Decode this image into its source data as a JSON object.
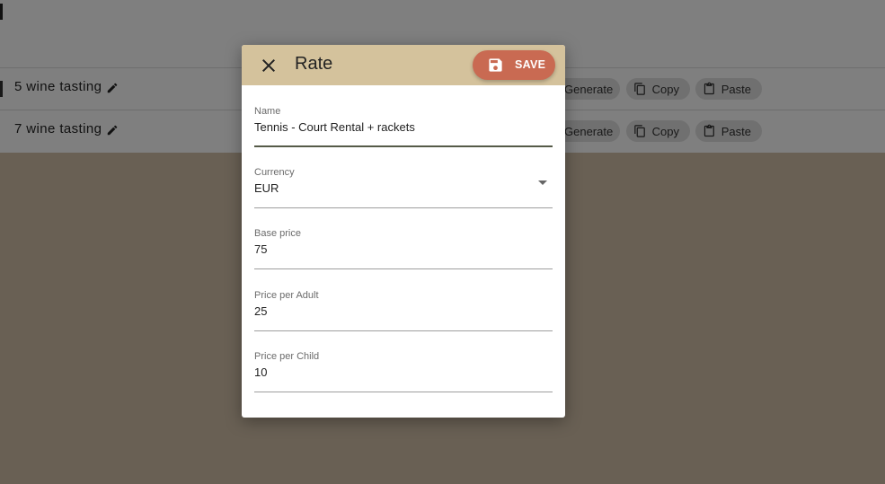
{
  "background": {
    "rows": [
      {
        "title": "5 wine tasting",
        "actions": {
          "generate": "Generate",
          "copy": "Copy",
          "paste": "Paste"
        }
      },
      {
        "title": "7 wine tasting",
        "actions": {
          "generate": "Generate",
          "copy": "Copy",
          "paste": "Paste"
        }
      }
    ]
  },
  "dialog": {
    "title": "Rate",
    "save_label": "SAVE",
    "fields": {
      "name": {
        "label": "Name",
        "value": "Tennis - Court Rental + rackets"
      },
      "currency": {
        "label": "Currency",
        "value": "EUR"
      },
      "base_price": {
        "label": "Base price",
        "value": "75"
      },
      "price_adult": {
        "label": "Price per Adult",
        "value": "25"
      },
      "price_child": {
        "label": "Price per Child",
        "value": "10"
      }
    }
  },
  "colors": {
    "header_bg": "#d4c29c",
    "save_button": "#c96a52",
    "page_bg": "#d2c1a8"
  },
  "icons": {
    "close": "close-icon",
    "save": "save-icon",
    "edit": "pencil-icon",
    "copy": "copy-icon",
    "paste": "clipboard-icon",
    "dropdown": "caret-down-icon"
  }
}
